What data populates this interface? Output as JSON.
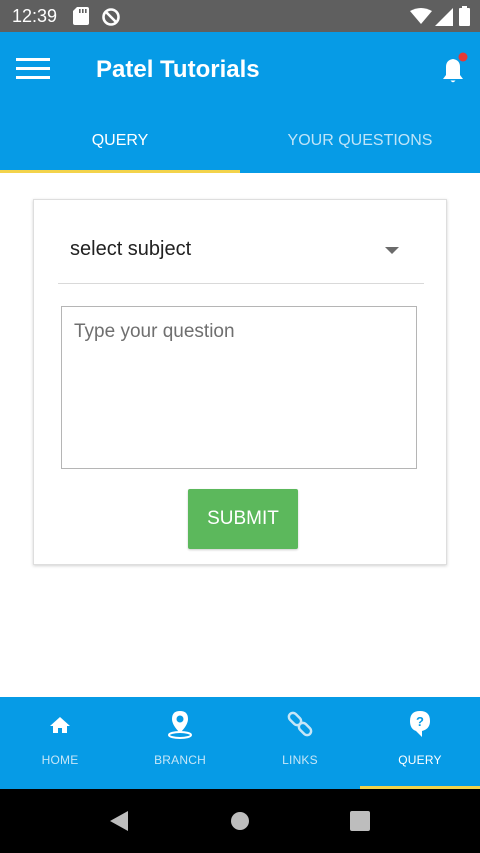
{
  "status": {
    "time": "12:39"
  },
  "header": {
    "title": "Patel Tutorials"
  },
  "tabs": [
    {
      "label": "QUERY",
      "active": true
    },
    {
      "label": "YOUR QUESTIONS",
      "active": false
    }
  ],
  "form": {
    "subject_value": "select subject",
    "question_placeholder": "Type your question",
    "submit_label": "SUBMIT"
  },
  "bottom_nav": [
    {
      "label": "HOME",
      "icon": "home-icon"
    },
    {
      "label": "BRANCH",
      "icon": "location-pin-icon"
    },
    {
      "label": "LINKS",
      "icon": "link-icon"
    },
    {
      "label": "QUERY",
      "icon": "help-icon",
      "active": true
    }
  ],
  "colors": {
    "primary": "#069be6",
    "accent": "#f3d34b",
    "submit": "#5cb85c",
    "notification_dot": "#e53935"
  }
}
